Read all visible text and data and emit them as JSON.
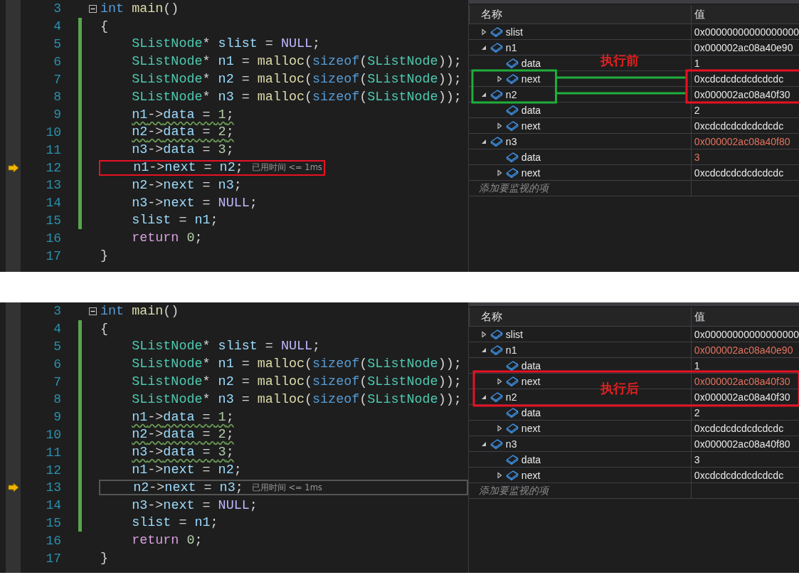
{
  "panels": [
    {
      "code": {
        "lines": [
          {
            "number": "3",
            "changed": false,
            "current": false,
            "marked": false,
            "squiggle": false,
            "fold": true,
            "indented": false,
            "tokens": [
              {
                "text": "int ",
                "kind": "keyword"
              },
              {
                "text": "main",
                "kind": "func"
              },
              {
                "text": "()",
                "kind": "plain"
              }
            ]
          },
          {
            "number": "4",
            "changed": true,
            "current": false,
            "marked": false,
            "squiggle": false,
            "fold": false,
            "indented": false,
            "tokens": [
              {
                "text": "{",
                "kind": "plain"
              }
            ]
          },
          {
            "number": "5",
            "changed": true,
            "current": false,
            "marked": false,
            "squiggle": false,
            "fold": false,
            "indented": true,
            "tokens": [
              {
                "text": "SListNode",
                "kind": "type"
              },
              {
                "text": "* ",
                "kind": "plain"
              },
              {
                "text": "slist",
                "kind": "ident"
              },
              {
                "text": " = ",
                "kind": "plain"
              },
              {
                "text": "NULL",
                "kind": "macro"
              },
              {
                "text": ";",
                "kind": "plain"
              }
            ]
          },
          {
            "number": "6",
            "changed": true,
            "current": false,
            "marked": false,
            "squiggle": false,
            "fold": false,
            "indented": true,
            "tokens": [
              {
                "text": "SListNode",
                "kind": "type"
              },
              {
                "text": "* ",
                "kind": "plain"
              },
              {
                "text": "n1",
                "kind": "ident"
              },
              {
                "text": " = ",
                "kind": "plain"
              },
              {
                "text": "malloc",
                "kind": "func"
              },
              {
                "text": "(",
                "kind": "plain"
              },
              {
                "text": "sizeof",
                "kind": "keyword"
              },
              {
                "text": "(",
                "kind": "plain"
              },
              {
                "text": "SListNode",
                "kind": "type"
              },
              {
                "text": "));",
                "kind": "plain"
              }
            ]
          },
          {
            "number": "7",
            "changed": true,
            "current": false,
            "marked": false,
            "squiggle": false,
            "fold": false,
            "indented": true,
            "tokens": [
              {
                "text": "SListNode",
                "kind": "type"
              },
              {
                "text": "* ",
                "kind": "plain"
              },
              {
                "text": "n2",
                "kind": "ident"
              },
              {
                "text": " = ",
                "kind": "plain"
              },
              {
                "text": "malloc",
                "kind": "func"
              },
              {
                "text": "(",
                "kind": "plain"
              },
              {
                "text": "sizeof",
                "kind": "keyword"
              },
              {
                "text": "(",
                "kind": "plain"
              },
              {
                "text": "SListNode",
                "kind": "type"
              },
              {
                "text": "));",
                "kind": "plain"
              }
            ]
          },
          {
            "number": "8",
            "changed": true,
            "current": false,
            "marked": false,
            "squiggle": false,
            "fold": false,
            "indented": true,
            "tokens": [
              {
                "text": "SListNode",
                "kind": "type"
              },
              {
                "text": "* ",
                "kind": "plain"
              },
              {
                "text": "n3",
                "kind": "ident"
              },
              {
                "text": " = ",
                "kind": "plain"
              },
              {
                "text": "malloc",
                "kind": "func"
              },
              {
                "text": "(",
                "kind": "plain"
              },
              {
                "text": "sizeof",
                "kind": "keyword"
              },
              {
                "text": "(",
                "kind": "plain"
              },
              {
                "text": "SListNode",
                "kind": "type"
              },
              {
                "text": "));",
                "kind": "plain"
              }
            ]
          },
          {
            "number": "9",
            "changed": true,
            "current": false,
            "marked": false,
            "squiggle": true,
            "fold": false,
            "indented": true,
            "tokens": [
              {
                "text": "n1",
                "kind": "ident"
              },
              {
                "text": "->",
                "kind": "plain"
              },
              {
                "text": "data",
                "kind": "ident"
              },
              {
                "text": " = ",
                "kind": "plain"
              },
              {
                "text": "1",
                "kind": "number"
              },
              {
                "text": ";",
                "kind": "plain"
              }
            ]
          },
          {
            "number": "10",
            "changed": true,
            "current": false,
            "marked": false,
            "squiggle": true,
            "fold": false,
            "indented": true,
            "tokens": [
              {
                "text": "n2",
                "kind": "ident"
              },
              {
                "text": "->",
                "kind": "plain"
              },
              {
                "text": "data",
                "kind": "ident"
              },
              {
                "text": " = ",
                "kind": "plain"
              },
              {
                "text": "2",
                "kind": "number"
              },
              {
                "text": ";",
                "kind": "plain"
              }
            ]
          },
          {
            "number": "11",
            "changed": true,
            "current": false,
            "marked": false,
            "squiggle": false,
            "fold": false,
            "indented": true,
            "tokens": [
              {
                "text": "n3",
                "kind": "ident"
              },
              {
                "text": "->",
                "kind": "plain"
              },
              {
                "text": "data",
                "kind": "ident"
              },
              {
                "text": " = ",
                "kind": "plain"
              },
              {
                "text": "3",
                "kind": "number"
              },
              {
                "text": ";",
                "kind": "plain"
              }
            ]
          },
          {
            "number": "12",
            "changed": true,
            "current": true,
            "marked": true,
            "squiggle": false,
            "fold": false,
            "indented": true,
            "hint": "已用时间 <= 1ms",
            "tokens": [
              {
                "text": "n1",
                "kind": "ident"
              },
              {
                "text": "->",
                "kind": "plain"
              },
              {
                "text": "next",
                "kind": "ident"
              },
              {
                "text": " = ",
                "kind": "plain"
              },
              {
                "text": "n2",
                "kind": "ident"
              },
              {
                "text": ";",
                "kind": "plain"
              }
            ]
          },
          {
            "number": "13",
            "changed": true,
            "current": false,
            "marked": false,
            "squiggle": false,
            "fold": false,
            "indented": true,
            "tokens": [
              {
                "text": "n2",
                "kind": "ident"
              },
              {
                "text": "->",
                "kind": "plain"
              },
              {
                "text": "next",
                "kind": "ident"
              },
              {
                "text": " = ",
                "kind": "plain"
              },
              {
                "text": "n3",
                "kind": "ident"
              },
              {
                "text": ";",
                "kind": "plain"
              }
            ]
          },
          {
            "number": "14",
            "changed": true,
            "current": false,
            "marked": false,
            "squiggle": false,
            "fold": false,
            "indented": true,
            "tokens": [
              {
                "text": "n3",
                "kind": "ident"
              },
              {
                "text": "->",
                "kind": "plain"
              },
              {
                "text": "next",
                "kind": "ident"
              },
              {
                "text": " = ",
                "kind": "plain"
              },
              {
                "text": "NULL",
                "kind": "macro"
              },
              {
                "text": ";",
                "kind": "plain"
              }
            ]
          },
          {
            "number": "15",
            "changed": true,
            "current": false,
            "marked": false,
            "squiggle": false,
            "fold": false,
            "indented": true,
            "tokens": [
              {
                "text": "slist",
                "kind": "ident"
              },
              {
                "text": " = ",
                "kind": "plain"
              },
              {
                "text": "n1",
                "kind": "ident"
              },
              {
                "text": ";",
                "kind": "plain"
              }
            ]
          },
          {
            "number": "16",
            "changed": false,
            "current": false,
            "marked": false,
            "squiggle": false,
            "fold": false,
            "indented": true,
            "tokens": [
              {
                "text": "return ",
                "kind": "control"
              },
              {
                "text": "0",
                "kind": "number"
              },
              {
                "text": ";",
                "kind": "plain"
              }
            ]
          },
          {
            "number": "17",
            "changed": false,
            "current": false,
            "marked": false,
            "squiggle": false,
            "fold": false,
            "indented": false,
            "tokens": [
              {
                "text": "}",
                "kind": "plain"
              }
            ]
          }
        ]
      },
      "watch": {
        "columns": [
          "名称",
          "值"
        ],
        "placeholder": "添加要监视的项",
        "annotation": {
          "kind": "link",
          "label": "执行前"
        },
        "rows": [
          {
            "name": "slist",
            "value": "0x00000000000000000",
            "kind": "node",
            "expanded": false,
            "changed": false,
            "marked": false
          },
          {
            "name": "n1",
            "value": "0x000002ac08a40e90",
            "kind": "node",
            "expanded": true,
            "changed": false,
            "marked": false,
            "children": [
              {
                "name": "data",
                "value": "1",
                "kind": "leaf",
                "changed": false,
                "marked": false
              },
              {
                "name": "next",
                "value": "0xcdcdcdcdcdcdcdc",
                "kind": "node",
                "expanded": false,
                "changed": false,
                "marked": true
              }
            ]
          },
          {
            "name": "n2",
            "value": "0x000002ac08a40f30",
            "kind": "node",
            "expanded": true,
            "changed": false,
            "marked": true,
            "children": [
              {
                "name": "data",
                "value": "2",
                "kind": "leaf",
                "changed": false,
                "marked": false
              },
              {
                "name": "next",
                "value": "0xcdcdcdcdcdcdcdc",
                "kind": "node",
                "expanded": false,
                "changed": false,
                "marked": false
              }
            ]
          },
          {
            "name": "n3",
            "value": "0x000002ac08a40f80",
            "kind": "node",
            "expanded": true,
            "changed": true,
            "marked": false,
            "children": [
              {
                "name": "data",
                "value": "3",
                "kind": "leaf",
                "changed": true,
                "marked": false
              },
              {
                "name": "next",
                "value": "0xcdcdcdcdcdcdcdc",
                "kind": "node",
                "expanded": false,
                "changed": false,
                "marked": false
              }
            ]
          }
        ]
      }
    },
    {
      "code": {
        "lines": [
          {
            "number": "3",
            "changed": false,
            "current": false,
            "marked": false,
            "squiggle": false,
            "fold": true,
            "indented": false,
            "tokens": [
              {
                "text": "int ",
                "kind": "keyword"
              },
              {
                "text": "main",
                "kind": "func"
              },
              {
                "text": "()",
                "kind": "plain"
              }
            ]
          },
          {
            "number": "4",
            "changed": true,
            "current": false,
            "marked": false,
            "squiggle": false,
            "fold": false,
            "indented": false,
            "tokens": [
              {
                "text": "{",
                "kind": "plain"
              }
            ]
          },
          {
            "number": "5",
            "changed": true,
            "current": false,
            "marked": false,
            "squiggle": false,
            "fold": false,
            "indented": true,
            "tokens": [
              {
                "text": "SListNode",
                "kind": "type"
              },
              {
                "text": "* ",
                "kind": "plain"
              },
              {
                "text": "slist",
                "kind": "ident"
              },
              {
                "text": " = ",
                "kind": "plain"
              },
              {
                "text": "NULL",
                "kind": "macro"
              },
              {
                "text": ";",
                "kind": "plain"
              }
            ]
          },
          {
            "number": "6",
            "changed": true,
            "current": false,
            "marked": false,
            "squiggle": false,
            "fold": false,
            "indented": true,
            "tokens": [
              {
                "text": "SListNode",
                "kind": "type"
              },
              {
                "text": "* ",
                "kind": "plain"
              },
              {
                "text": "n1",
                "kind": "ident"
              },
              {
                "text": " = ",
                "kind": "plain"
              },
              {
                "text": "malloc",
                "kind": "func"
              },
              {
                "text": "(",
                "kind": "plain"
              },
              {
                "text": "sizeof",
                "kind": "keyword"
              },
              {
                "text": "(",
                "kind": "plain"
              },
              {
                "text": "SListNode",
                "kind": "type"
              },
              {
                "text": "));",
                "kind": "plain"
              }
            ]
          },
          {
            "number": "7",
            "changed": true,
            "current": false,
            "marked": false,
            "squiggle": false,
            "fold": false,
            "indented": true,
            "tokens": [
              {
                "text": "SListNode",
                "kind": "type"
              },
              {
                "text": "* ",
                "kind": "plain"
              },
              {
                "text": "n2",
                "kind": "ident"
              },
              {
                "text": " = ",
                "kind": "plain"
              },
              {
                "text": "malloc",
                "kind": "func"
              },
              {
                "text": "(",
                "kind": "plain"
              },
              {
                "text": "sizeof",
                "kind": "keyword"
              },
              {
                "text": "(",
                "kind": "plain"
              },
              {
                "text": "SListNode",
                "kind": "type"
              },
              {
                "text": "));",
                "kind": "plain"
              }
            ]
          },
          {
            "number": "8",
            "changed": true,
            "current": false,
            "marked": false,
            "squiggle": false,
            "fold": false,
            "indented": true,
            "tokens": [
              {
                "text": "SListNode",
                "kind": "type"
              },
              {
                "text": "* ",
                "kind": "plain"
              },
              {
                "text": "n3",
                "kind": "ident"
              },
              {
                "text": " = ",
                "kind": "plain"
              },
              {
                "text": "malloc",
                "kind": "func"
              },
              {
                "text": "(",
                "kind": "plain"
              },
              {
                "text": "sizeof",
                "kind": "keyword"
              },
              {
                "text": "(",
                "kind": "plain"
              },
              {
                "text": "SListNode",
                "kind": "type"
              },
              {
                "text": "));",
                "kind": "plain"
              }
            ]
          },
          {
            "number": "9",
            "changed": true,
            "current": false,
            "marked": false,
            "squiggle": true,
            "fold": false,
            "indented": true,
            "tokens": [
              {
                "text": "n1",
                "kind": "ident"
              },
              {
                "text": "->",
                "kind": "plain"
              },
              {
                "text": "data",
                "kind": "ident"
              },
              {
                "text": " = ",
                "kind": "plain"
              },
              {
                "text": "1",
                "kind": "number"
              },
              {
                "text": ";",
                "kind": "plain"
              }
            ]
          },
          {
            "number": "10",
            "changed": true,
            "current": false,
            "marked": false,
            "squiggle": true,
            "fold": false,
            "indented": true,
            "tokens": [
              {
                "text": "n2",
                "kind": "ident"
              },
              {
                "text": "->",
                "kind": "plain"
              },
              {
                "text": "data",
                "kind": "ident"
              },
              {
                "text": " = ",
                "kind": "plain"
              },
              {
                "text": "2",
                "kind": "number"
              },
              {
                "text": ";",
                "kind": "plain"
              }
            ]
          },
          {
            "number": "11",
            "changed": true,
            "current": false,
            "marked": false,
            "squiggle": true,
            "fold": false,
            "indented": true,
            "tokens": [
              {
                "text": "n3",
                "kind": "ident"
              },
              {
                "text": "->",
                "kind": "plain"
              },
              {
                "text": "data",
                "kind": "ident"
              },
              {
                "text": " = ",
                "kind": "plain"
              },
              {
                "text": "3",
                "kind": "number"
              },
              {
                "text": ";",
                "kind": "plain"
              }
            ]
          },
          {
            "number": "12",
            "changed": true,
            "current": false,
            "marked": false,
            "squiggle": false,
            "fold": false,
            "indented": true,
            "tokens": [
              {
                "text": "n1",
                "kind": "ident"
              },
              {
                "text": "->",
                "kind": "plain"
              },
              {
                "text": "next",
                "kind": "ident"
              },
              {
                "text": " = ",
                "kind": "plain"
              },
              {
                "text": "n2",
                "kind": "ident"
              },
              {
                "text": ";",
                "kind": "plain"
              }
            ]
          },
          {
            "number": "13",
            "changed": true,
            "current": true,
            "marked": false,
            "squiggle": false,
            "fold": false,
            "indented": true,
            "hint": "已用时间 <= 1ms",
            "tokens": [
              {
                "text": "n2",
                "kind": "ident"
              },
              {
                "text": "->",
                "kind": "plain"
              },
              {
                "text": "next",
                "kind": "ident"
              },
              {
                "text": " = ",
                "kind": "plain"
              },
              {
                "text": "n3",
                "kind": "ident"
              },
              {
                "text": ";",
                "kind": "plain"
              }
            ]
          },
          {
            "number": "14",
            "changed": true,
            "current": false,
            "marked": false,
            "squiggle": false,
            "fold": false,
            "indented": true,
            "tokens": [
              {
                "text": "n3",
                "kind": "ident"
              },
              {
                "text": "->",
                "kind": "plain"
              },
              {
                "text": "next",
                "kind": "ident"
              },
              {
                "text": " = ",
                "kind": "plain"
              },
              {
                "text": "NULL",
                "kind": "macro"
              },
              {
                "text": ";",
                "kind": "plain"
              }
            ]
          },
          {
            "number": "15",
            "changed": true,
            "current": false,
            "marked": false,
            "squiggle": false,
            "fold": false,
            "indented": true,
            "tokens": [
              {
                "text": "slist",
                "kind": "ident"
              },
              {
                "text": " = ",
                "kind": "plain"
              },
              {
                "text": "n1",
                "kind": "ident"
              },
              {
                "text": ";",
                "kind": "plain"
              }
            ]
          },
          {
            "number": "16",
            "changed": false,
            "current": false,
            "marked": false,
            "squiggle": false,
            "fold": false,
            "indented": true,
            "tokens": [
              {
                "text": "return ",
                "kind": "control"
              },
              {
                "text": "0",
                "kind": "number"
              },
              {
                "text": ";",
                "kind": "plain"
              }
            ]
          },
          {
            "number": "17",
            "changed": false,
            "current": false,
            "marked": false,
            "squiggle": false,
            "fold": false,
            "indented": false,
            "tokens": [
              {
                "text": "}",
                "kind": "plain"
              }
            ]
          }
        ]
      },
      "watch": {
        "columns": [
          "名称",
          "值"
        ],
        "placeholder": "添加要监视的项",
        "annotation": {
          "kind": "box",
          "label": "执行后"
        },
        "rows": [
          {
            "name": "slist",
            "value": "0x00000000000000000",
            "kind": "node",
            "expanded": false,
            "changed": false,
            "marked": false
          },
          {
            "name": "n1",
            "value": "0x000002ac08a40e90",
            "kind": "node",
            "expanded": true,
            "changed": true,
            "marked": false,
            "children": [
              {
                "name": "data",
                "value": "1",
                "kind": "leaf",
                "changed": false,
                "marked": false
              },
              {
                "name": "next",
                "value": "0x000002ac08a40f30",
                "kind": "node",
                "expanded": false,
                "changed": true,
                "marked": true
              }
            ]
          },
          {
            "name": "n2",
            "value": "0x000002ac08a40f30",
            "kind": "node",
            "expanded": true,
            "changed": false,
            "marked": true,
            "children": [
              {
                "name": "data",
                "value": "2",
                "kind": "leaf",
                "changed": false,
                "marked": false
              },
              {
                "name": "next",
                "value": "0xcdcdcdcdcdcdcdc",
                "kind": "node",
                "expanded": false,
                "changed": false,
                "marked": false
              }
            ]
          },
          {
            "name": "n3",
            "value": "0x000002ac08a40f80",
            "kind": "node",
            "expanded": true,
            "changed": false,
            "marked": false,
            "children": [
              {
                "name": "data",
                "value": "3",
                "kind": "leaf",
                "changed": false,
                "marked": false
              },
              {
                "name": "next",
                "value": "0xcdcdcdcdcdcdcdc",
                "kind": "node",
                "expanded": false,
                "changed": false,
                "marked": false
              }
            ]
          }
        ]
      }
    }
  ]
}
